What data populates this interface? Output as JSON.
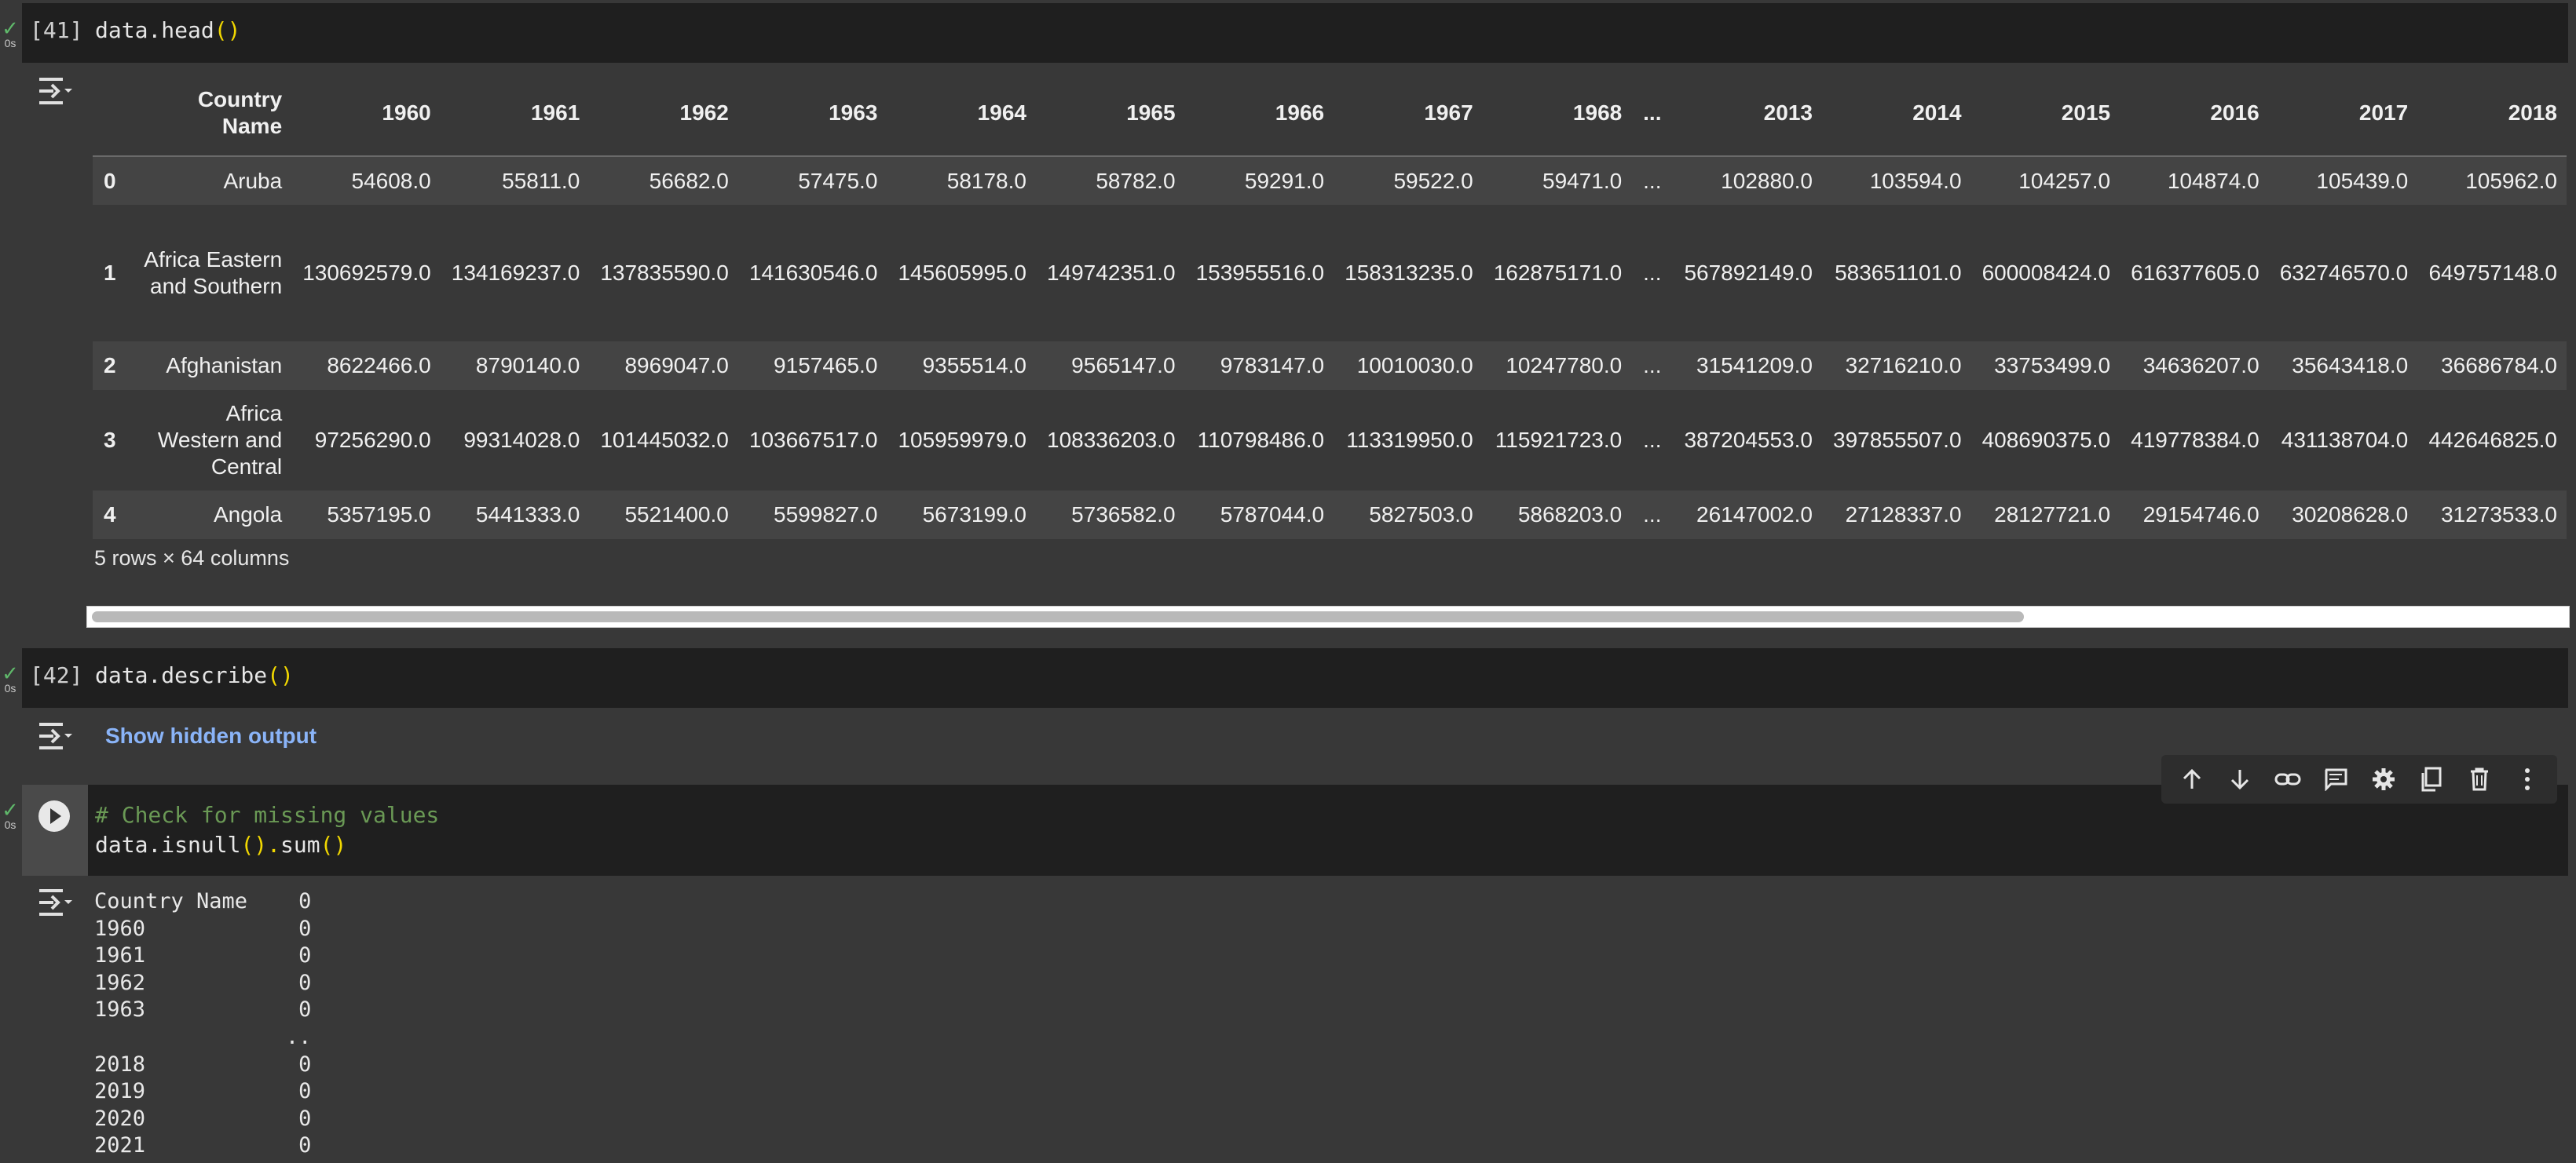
{
  "cells": [
    {
      "exec_count": "[41]",
      "status_time": "0s",
      "code": "data.head",
      "code_parens": "()"
    },
    {
      "exec_count": "[42]",
      "status_time": "0s",
      "code": "data.describe",
      "code_parens": "()",
      "hidden_output_label": "Show hidden output"
    },
    {
      "status_time": "0s",
      "comment": "# Check for missing values",
      "code_a": "data.isnull",
      "code_b": "().",
      "code_c": "sum",
      "code_d": "()"
    }
  ],
  "dataframe": {
    "columns": [
      "Country Name",
      "1960",
      "1961",
      "1962",
      "1963",
      "1964",
      "1965",
      "1966",
      "1967",
      "1968",
      "...",
      "2013",
      "2014",
      "2015",
      "2016",
      "2017",
      "2018"
    ],
    "rows": [
      {
        "index": "0",
        "name": "Aruba",
        "values": [
          "54608.0",
          "55811.0",
          "56682.0",
          "57475.0",
          "58178.0",
          "58782.0",
          "59291.0",
          "59522.0",
          "59471.0",
          "...",
          "102880.0",
          "103594.0",
          "104257.0",
          "104874.0",
          "105439.0",
          "105962.0"
        ]
      },
      {
        "index": "1",
        "name": "Africa Eastern and Southern",
        "values": [
          "130692579.0",
          "134169237.0",
          "137835590.0",
          "141630546.0",
          "145605995.0",
          "149742351.0",
          "153955516.0",
          "158313235.0",
          "162875171.0",
          "...",
          "567892149.0",
          "583651101.0",
          "600008424.0",
          "616377605.0",
          "632746570.0",
          "649757148.0"
        ]
      },
      {
        "index": "2",
        "name": "Afghanistan",
        "values": [
          "8622466.0",
          "8790140.0",
          "8969047.0",
          "9157465.0",
          "9355514.0",
          "9565147.0",
          "9783147.0",
          "10010030.0",
          "10247780.0",
          "...",
          "31541209.0",
          "32716210.0",
          "33753499.0",
          "34636207.0",
          "35643418.0",
          "36686784.0"
        ]
      },
      {
        "index": "3",
        "name": "Africa Western and Central",
        "values": [
          "97256290.0",
          "99314028.0",
          "101445032.0",
          "103667517.0",
          "105959979.0",
          "108336203.0",
          "110798486.0",
          "113319950.0",
          "115921723.0",
          "...",
          "387204553.0",
          "397855507.0",
          "408690375.0",
          "419778384.0",
          "431138704.0",
          "442646825.0"
        ]
      },
      {
        "index": "4",
        "name": "Angola",
        "values": [
          "5357195.0",
          "5441333.0",
          "5521400.0",
          "5599827.0",
          "5673199.0",
          "5736582.0",
          "5787044.0",
          "5827503.0",
          "5868203.0",
          "...",
          "26147002.0",
          "27128337.0",
          "28127721.0",
          "29154746.0",
          "30208628.0",
          "31273533.0"
        ]
      }
    ],
    "shape": "5 rows × 64 columns"
  },
  "isnull_output": {
    "lines": [
      "Country Name    0",
      "1960            0",
      "1961            0",
      "1962            0",
      "1963            0",
      "               ..",
      "2018            0",
      "2019            0",
      "2020            0",
      "2021            0"
    ]
  },
  "toolbar": {
    "icons": [
      "arrow-up-icon",
      "arrow-down-icon",
      "link-icon",
      "comment-icon",
      "gear-icon",
      "mirror-cell-icon",
      "trash-icon",
      "more-vert-icon"
    ]
  }
}
